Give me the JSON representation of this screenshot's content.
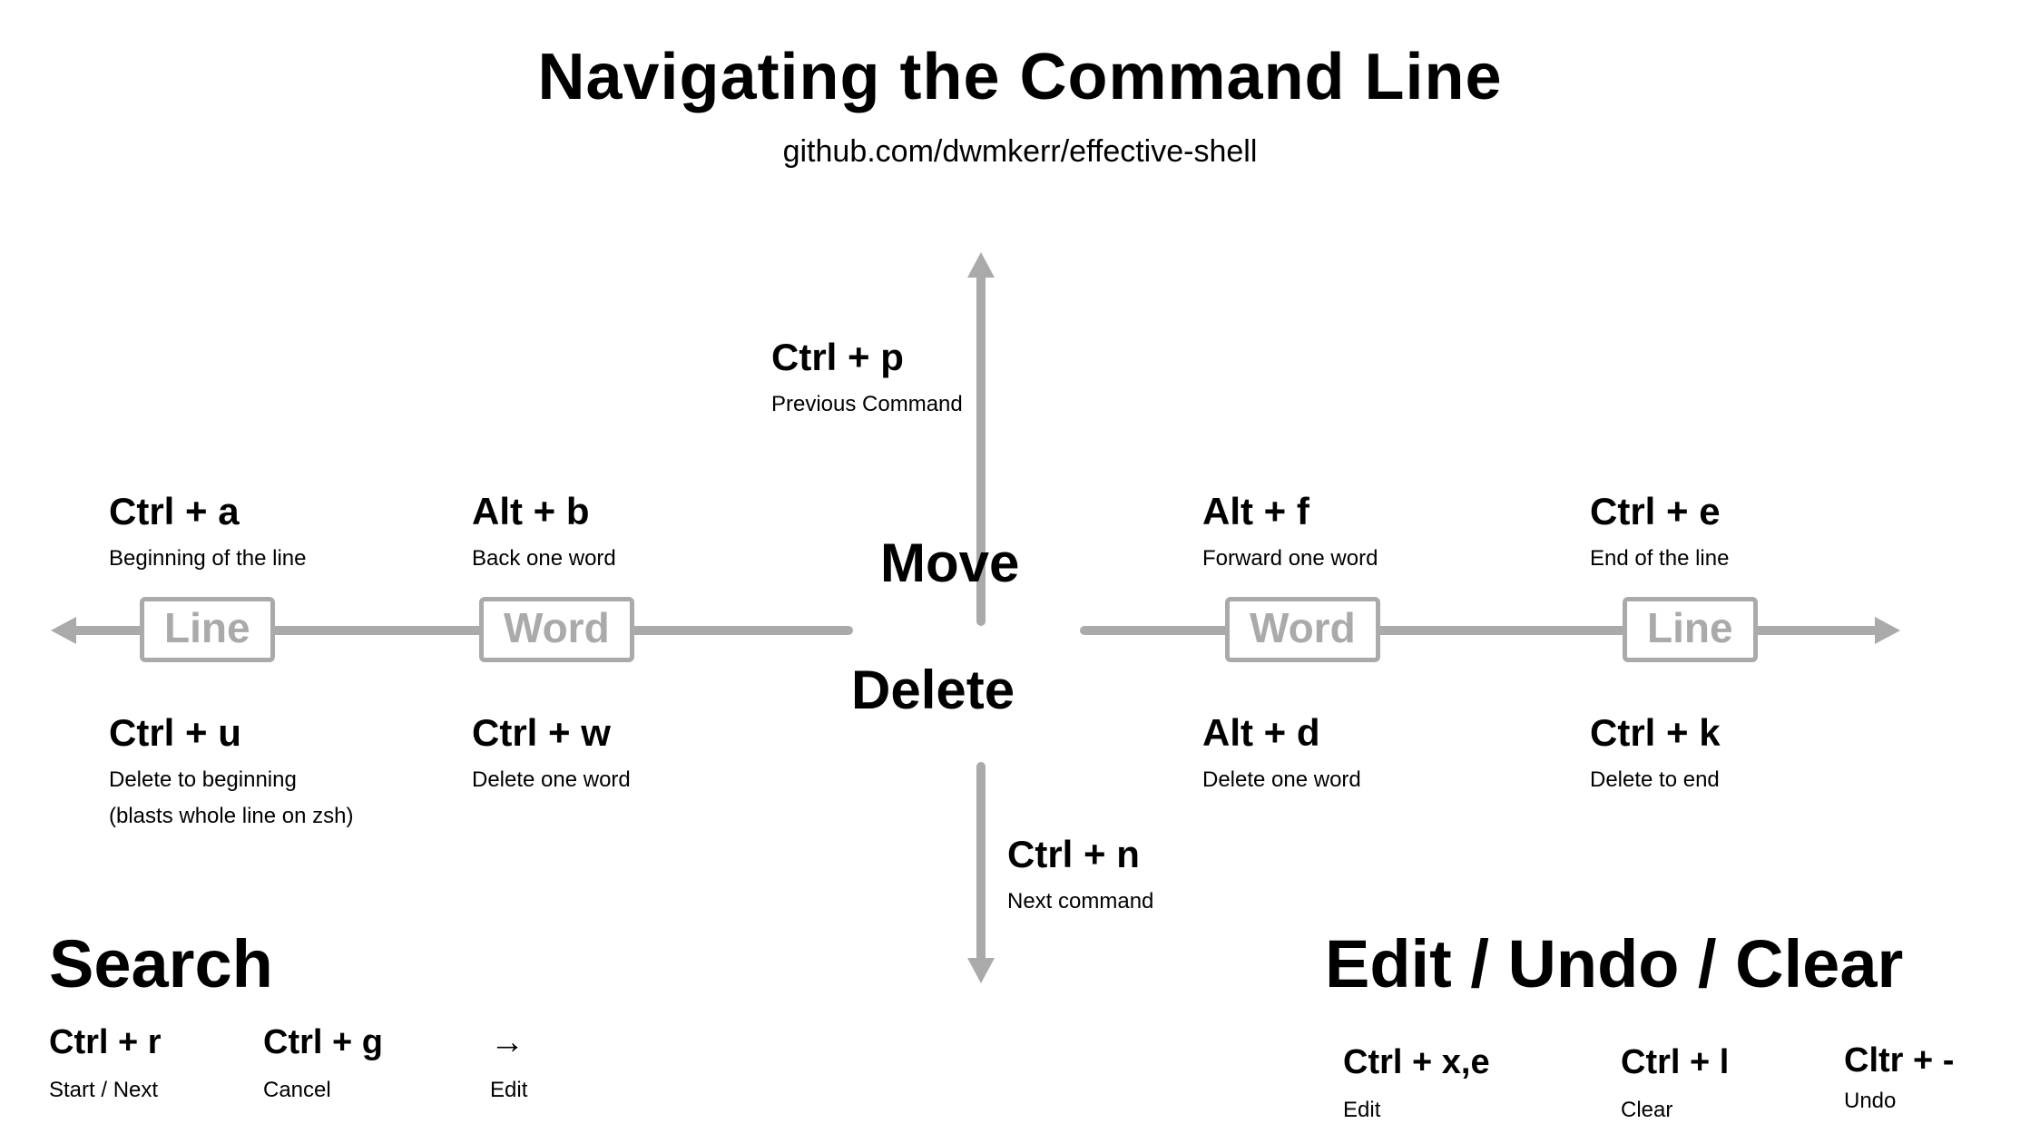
{
  "header": {
    "title": "Navigating the Command Line",
    "subtitle": "github.com/dwmkerr/effective-shell"
  },
  "center": {
    "move_label": "Move",
    "delete_label": "Delete"
  },
  "scopes": {
    "line": "Line",
    "word": "Word"
  },
  "up": {
    "key": "Ctrl + p",
    "desc": "Previous Command"
  },
  "down": {
    "key": "Ctrl + n",
    "desc": "Next command"
  },
  "left_line_move": {
    "key": "Ctrl + a",
    "desc": "Beginning of the line"
  },
  "left_word_move": {
    "key": "Alt + b",
    "desc": "Back one word"
  },
  "right_word_move": {
    "key": "Alt + f",
    "desc": "Forward one word"
  },
  "right_line_move": {
    "key": "Ctrl + e",
    "desc": "End of the line"
  },
  "left_line_delete": {
    "key": "Ctrl + u",
    "desc": "Delete to beginning",
    "desc2": "(blasts whole line on zsh)"
  },
  "left_word_delete": {
    "key": "Ctrl + w",
    "desc": "Delete one word"
  },
  "right_word_delete": {
    "key": "Alt + d",
    "desc": "Delete one word"
  },
  "right_line_delete": {
    "key": "Ctrl + k",
    "desc": "Delete to end"
  },
  "search": {
    "heading": "Search",
    "items": [
      {
        "key": "Ctrl + r",
        "desc": "Start / Next"
      },
      {
        "key": "Ctrl + g",
        "desc": "Cancel"
      },
      {
        "key": "→",
        "desc": "Edit"
      }
    ]
  },
  "edit": {
    "heading": "Edit / Undo / Clear",
    "items": [
      {
        "key": "Ctrl + x,e",
        "desc": "Edit"
      },
      {
        "key": "Ctrl + l",
        "desc": "Clear"
      },
      {
        "key": "Cltr + -",
        "desc": "Undo"
      }
    ]
  }
}
